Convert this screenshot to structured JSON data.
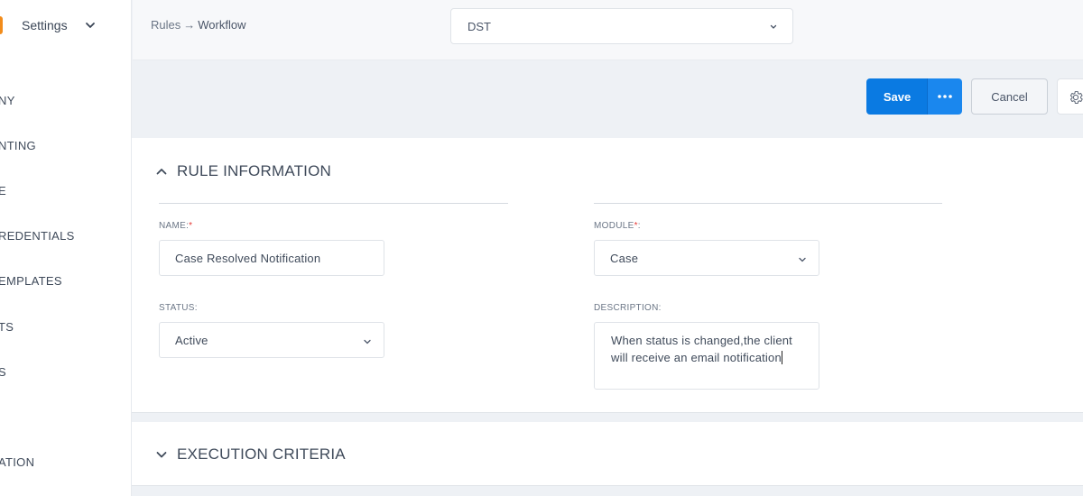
{
  "sidebar": {
    "title": "Settings",
    "items": [
      {
        "label": "NY"
      },
      {
        "label": "NTING"
      },
      {
        "label": "E"
      },
      {
        "label": "REDENTIALS"
      },
      {
        "label": "EMPLATES"
      },
      {
        "label": "TS"
      },
      {
        "label": "S"
      },
      {
        "label": "ATION"
      }
    ]
  },
  "breadcrumb": {
    "parent": "Rules",
    "separator": "→",
    "current": "Workflow"
  },
  "company_select": {
    "value": "DST"
  },
  "actions": {
    "save_label": "Save",
    "cancel_label": "Cancel"
  },
  "rule_info": {
    "title": "RULE INFORMATION",
    "name_label": "NAME:",
    "name_value": "Case Resolved Notification",
    "module_label": "MODULE",
    "module_value": "Case",
    "status_label": "STATUS:",
    "status_value": "Active",
    "description_label": "DESCRIPTION:",
    "description_value": "When status is changed,the client will receive an email notification"
  },
  "execution_criteria": {
    "title": "EXECUTION CRITERIA"
  },
  "colors": {
    "primary": "#0a7ae2",
    "brand": "#f28c1b",
    "required": "#e53935"
  }
}
